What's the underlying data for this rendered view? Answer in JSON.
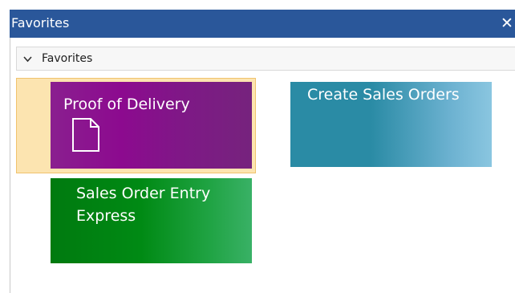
{
  "window": {
    "title": "Favorites",
    "close_label": "✕"
  },
  "group": {
    "label": "Favorites",
    "expanded": true
  },
  "tiles": [
    {
      "label": "Proof of Delivery",
      "icon": "document-icon",
      "selected": true,
      "color": "#8c0a8f"
    },
    {
      "label": "Create Sales Orders",
      "icon": "",
      "selected": false,
      "color": "#2a8ba5"
    },
    {
      "label_line1": "Sales Order Entry",
      "label_line2": "Express",
      "icon": "",
      "selected": false,
      "color": "#008a14"
    }
  ],
  "colors": {
    "titlebar": "#2a579a",
    "selection": "#fce4b0"
  }
}
